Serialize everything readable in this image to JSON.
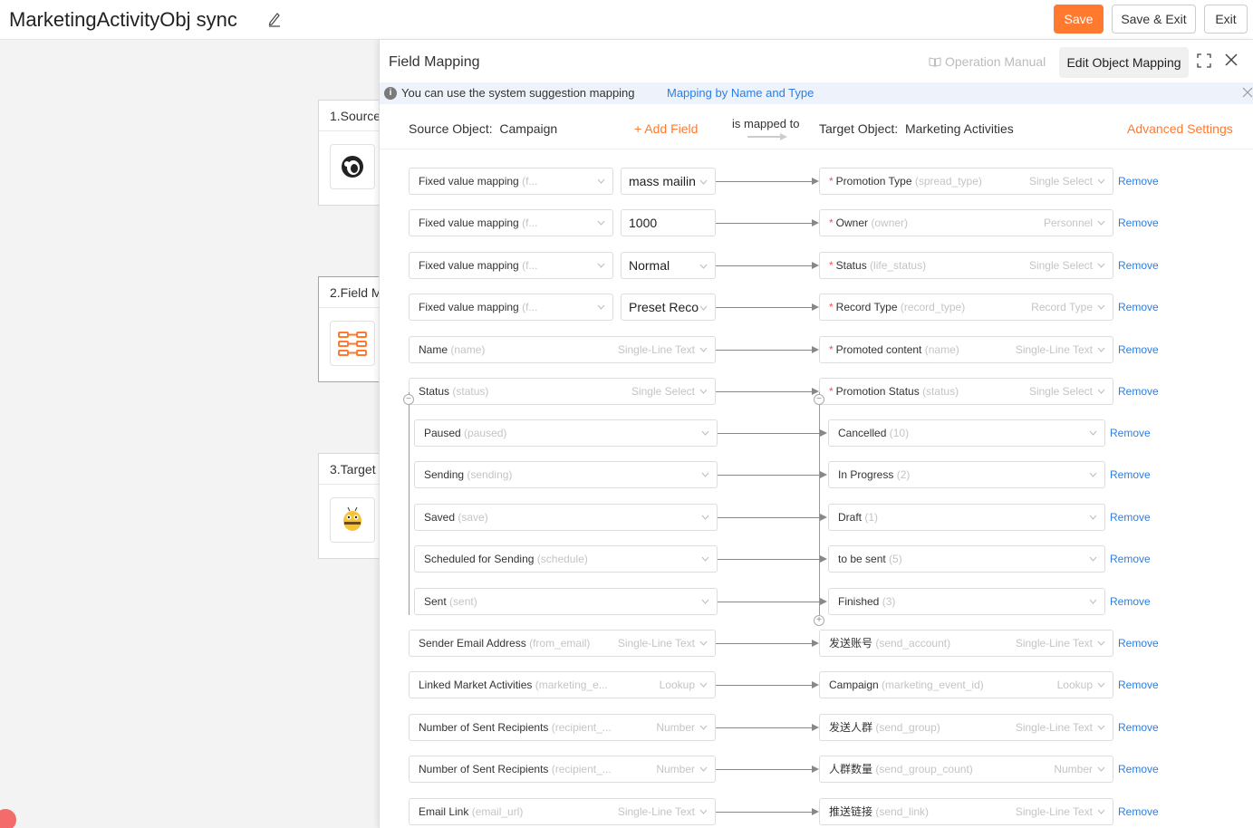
{
  "app": {
    "title": "MarketingActivityObj sync",
    "save": "Save",
    "save_exit": "Save & Exit",
    "exit": "Exit"
  },
  "steps": [
    {
      "label": "1.Source",
      "icon": "mailchimp-logo-icon"
    },
    {
      "label": "2.Field M",
      "icon": "field-mapping-icon",
      "active": true
    },
    {
      "label": "3.Target",
      "icon": "target-bee-logo-icon"
    }
  ],
  "panel": {
    "title": "Field Mapping",
    "operation_manual": "Operation Manual",
    "edit_object_mapping": "Edit Object Mapping",
    "tip": "You can use the system suggestion mapping",
    "tip_link": "Mapping by Name and Type",
    "source_object_label": "Source Object:",
    "source_object": "Campaign",
    "add_field": "Add Field",
    "is_mapped_to": "is mapped to",
    "target_object_label": "Target Object:",
    "target_object": "Marketing Activities",
    "advanced_settings": "Advanced Settings",
    "remove": "Remove"
  },
  "colors": {
    "accent": "#ff7a2f",
    "link": "#2d7ee0",
    "required": "#ff4d4f"
  },
  "rows": [
    {
      "src": {
        "name": "Fixed value mapping",
        "code": "(f...",
        "type": ""
      },
      "value": "mass mailin",
      "value_select": true,
      "tgt": {
        "name": "Promotion Type",
        "code": "(spread_type)",
        "type": "Single Select",
        "required": true
      }
    },
    {
      "src": {
        "name": "Fixed value mapping",
        "code": "(f...",
        "type": ""
      },
      "value": "1000",
      "value_select": false,
      "tgt": {
        "name": "Owner",
        "code": "(owner)",
        "type": "Personnel",
        "required": true
      }
    },
    {
      "src": {
        "name": "Fixed value mapping",
        "code": "(f...",
        "type": ""
      },
      "value": "Normal",
      "value_select": true,
      "tgt": {
        "name": "Status",
        "code": "(life_status)",
        "type": "Single Select",
        "required": true
      }
    },
    {
      "src": {
        "name": "Fixed value mapping",
        "code": "(f...",
        "type": ""
      },
      "value": "Preset Reco",
      "value_select": true,
      "tgt": {
        "name": "Record Type",
        "code": "(record_type)",
        "type": "Record Type",
        "required": true
      }
    },
    {
      "src": {
        "name": "Name",
        "code": "(name)",
        "type": "Single-Line Text"
      },
      "tgt": {
        "name": "Promoted content",
        "code": "(name)",
        "type": "Single-Line Text",
        "required": true
      }
    },
    {
      "src": {
        "name": "Status",
        "code": "(status)",
        "type": "Single Select"
      },
      "tgt": {
        "name": "Promotion Status",
        "code": "(status)",
        "type": "Single Select",
        "required": true
      }
    }
  ],
  "options": [
    {
      "src": {
        "name": "Paused",
        "code": "(paused)"
      },
      "tgt": {
        "name": "Cancelled",
        "code": "(10)"
      }
    },
    {
      "src": {
        "name": "Sending",
        "code": "(sending)"
      },
      "tgt": {
        "name": "In Progress",
        "code": "(2)"
      }
    },
    {
      "src": {
        "name": "Saved",
        "code": "(save)"
      },
      "tgt": {
        "name": "Draft",
        "code": "(1)"
      }
    },
    {
      "src": {
        "name": "Scheduled for Sending",
        "code": "(schedule)"
      },
      "tgt": {
        "name": "to be sent",
        "code": "(5)"
      }
    },
    {
      "src": {
        "name": "Sent",
        "code": "(sent)"
      },
      "tgt": {
        "name": "Finished",
        "code": "(3)"
      }
    }
  ],
  "rows2": [
    {
      "src": {
        "name": "Sender Email Address",
        "code": "(from_email)",
        "type": "Single-Line Text"
      },
      "tgt": {
        "name": "发送账号",
        "code": "(send_account)",
        "type": "Single-Line Text"
      }
    },
    {
      "src": {
        "name": "Linked Market Activities",
        "code": "(marketing_e...",
        "type": "Lookup"
      },
      "tgt": {
        "name": "Campaign",
        "code": "(marketing_event_id)",
        "type": "Lookup"
      }
    },
    {
      "src": {
        "name": "Number of Sent Recipients",
        "code": "(recipient_...",
        "type": "Number"
      },
      "tgt": {
        "name": "发送人群",
        "code": "(send_group)",
        "type": "Single-Line Text"
      }
    },
    {
      "src": {
        "name": "Number of Sent Recipients",
        "code": "(recipient_...",
        "type": "Number"
      },
      "tgt": {
        "name": "人群数量",
        "code": "(send_group_count)",
        "type": "Number"
      }
    },
    {
      "src": {
        "name": "Email Link",
        "code": "(email_url)",
        "type": "Single-Line Text"
      },
      "tgt": {
        "name": "推送链接",
        "code": "(send_link)",
        "type": "Single-Line Text"
      }
    }
  ]
}
